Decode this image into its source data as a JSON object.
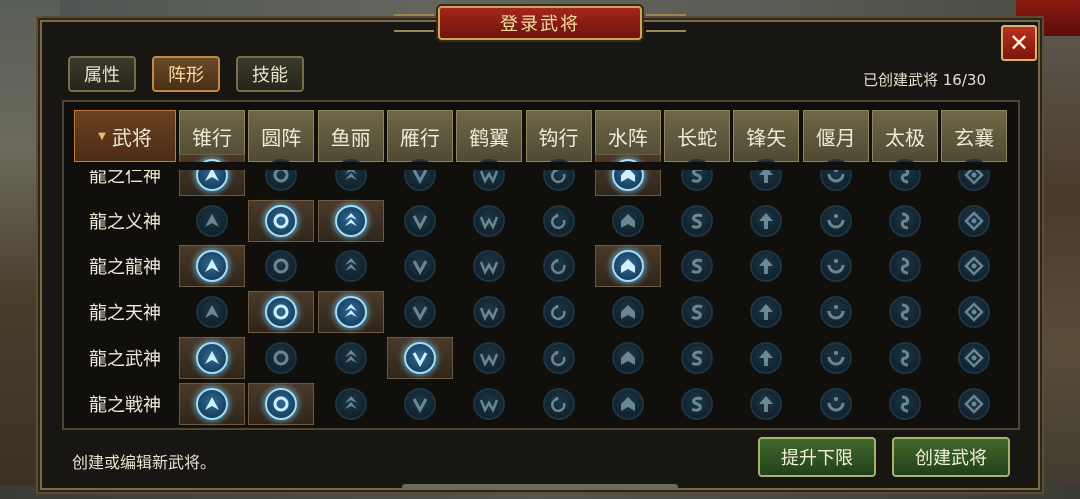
{
  "window": {
    "title": "登录武将",
    "close_symbol": "✕"
  },
  "tabs": [
    {
      "label": "属性",
      "active": false
    },
    {
      "label": "阵形",
      "active": true
    },
    {
      "label": "技能",
      "active": false
    }
  ],
  "count_label": "已创建武将 16/30",
  "table": {
    "first_header": "武将",
    "columns": [
      "锥行",
      "圆阵",
      "鱼丽",
      "雁行",
      "鹤翼",
      "钩行",
      "水阵",
      "长蛇",
      "锋矢",
      "偃月",
      "太极",
      "玄襄"
    ],
    "column_icons": [
      "arrow-up-icon",
      "ring-icon",
      "fish-scale-icon",
      "chevron-v-icon",
      "wing-icon",
      "hook-icon",
      "wave-icon",
      "snake-icon",
      "arrow-icon",
      "crescent-icon",
      "taiji-icon",
      "diamond-icon"
    ],
    "rows": [
      {
        "name": "龍之仁神",
        "active": [
          0,
          6
        ]
      },
      {
        "name": "龍之义神",
        "active": [
          1,
          2
        ]
      },
      {
        "name": "龍之龍神",
        "active": [
          0,
          6
        ]
      },
      {
        "name": "龍之天神",
        "active": [
          1,
          2
        ]
      },
      {
        "name": "龍之武神",
        "active": [
          0,
          3
        ]
      },
      {
        "name": "龍之戦神",
        "active": [
          0,
          1
        ]
      }
    ]
  },
  "footer": {
    "hint": "创建或编辑新武将。",
    "raise_limit_label": "提升下限",
    "create_label": "创建武将"
  },
  "colors": {
    "active_glow": "#9fe0ff",
    "active_tab": "#c28a44",
    "title_red": "#a3261d"
  }
}
